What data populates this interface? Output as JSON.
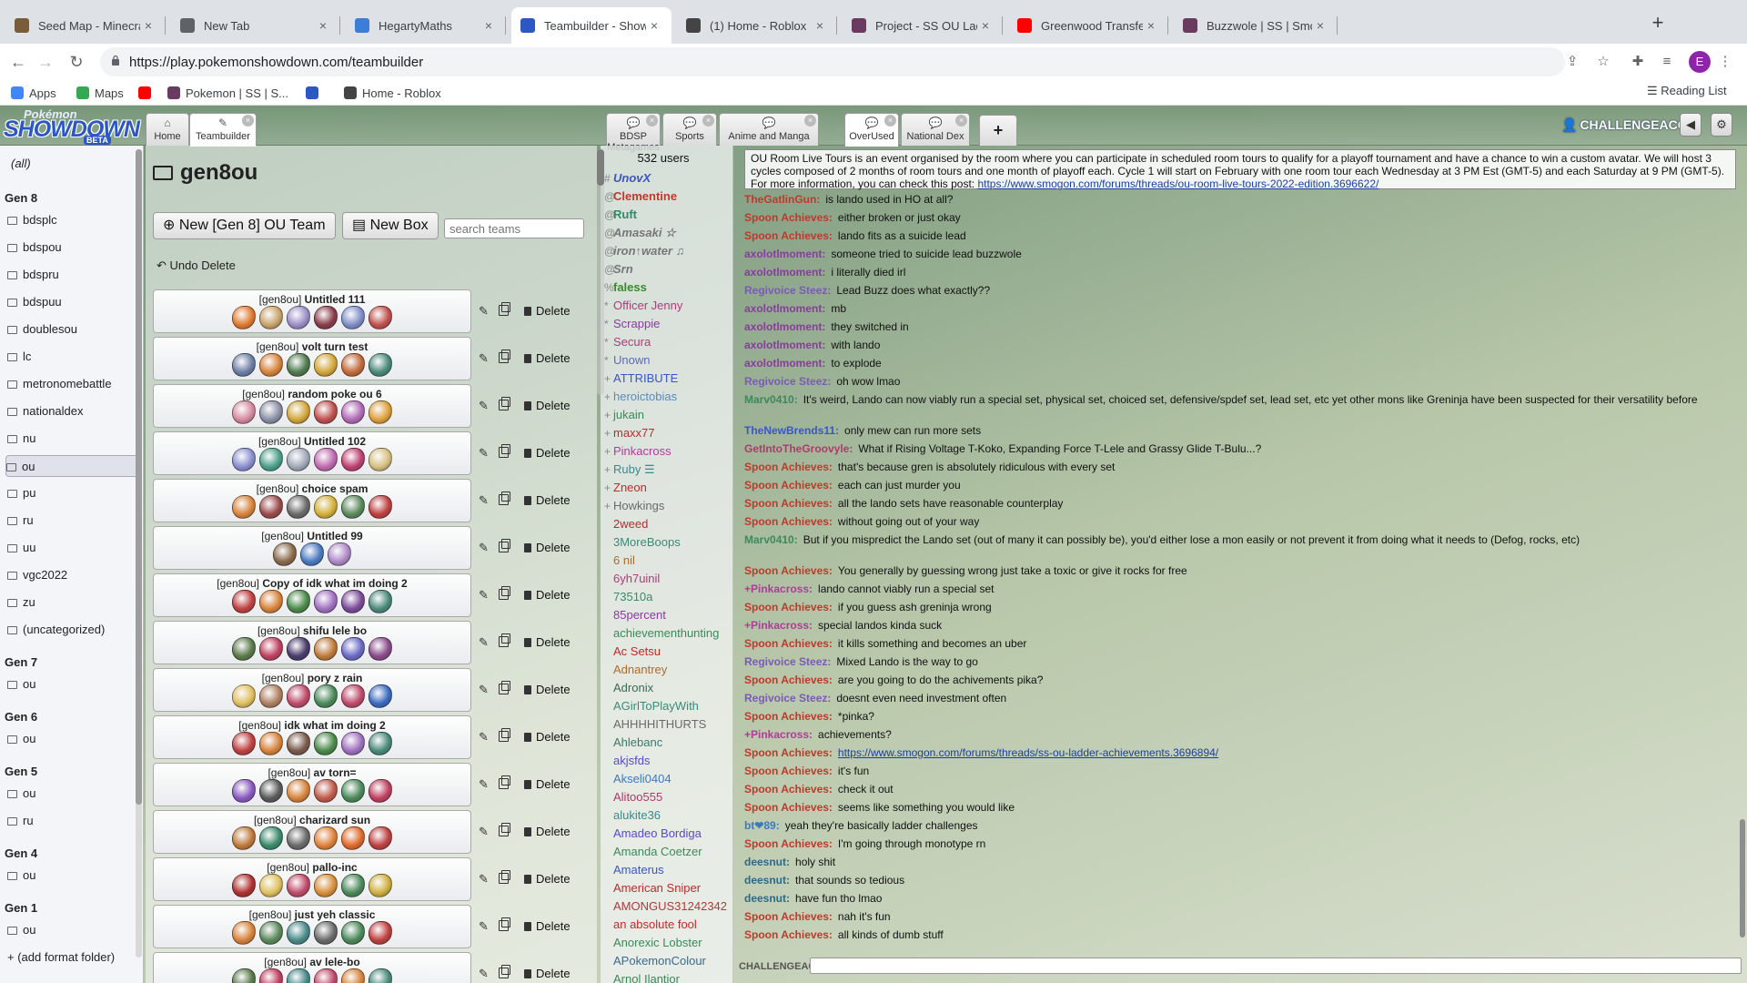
{
  "browser": {
    "tabs": [
      {
        "title": "Seed Map - Minecraft App",
        "icon": "minecraft-icon",
        "color": "#7a5c3a",
        "active": false
      },
      {
        "title": "New Tab",
        "icon": "chrome-icon",
        "color": "#5f6368",
        "active": false
      },
      {
        "title": "HegartyMaths",
        "icon": "hegartymaths-icon",
        "color": "#3b7dd8",
        "active": false
      },
      {
        "title": "Teambuilder - Showdown!",
        "icon": "showdown-icon",
        "color": "#2d58c4",
        "active": true
      },
      {
        "title": "(1) Home - Roblox",
        "icon": "roblox-icon",
        "color": "#444444",
        "active": false
      },
      {
        "title": "Project - SS OU Ladder Ach",
        "icon": "smogon-icon",
        "color": "#6a3b5e",
        "active": false
      },
      {
        "title": "Greenwood Transfer Re",
        "icon": "youtube-icon",
        "color": "#ff0000",
        "active": false
      },
      {
        "title": "Buzzwole | SS | Smogon Str",
        "icon": "smogon-icon",
        "color": "#6a3b5e",
        "active": false
      }
    ],
    "url": "https://play.pokemonshowdown.com/teambuilder",
    "profile_initial": "E",
    "bookmarks": [
      {
        "label": "Apps",
        "icon": "apps-grid-icon",
        "color": "#4285f4"
      },
      {
        "label": "Maps",
        "icon": "maps-pin-icon",
        "color": "#34a853"
      },
      {
        "label": "",
        "icon": "youtube-icon",
        "color": "#ff0000"
      },
      {
        "label": "Pokemon | SS | S...",
        "icon": "smogon-icon",
        "color": "#6a3b5e"
      },
      {
        "label": "",
        "icon": "showdown-s-icon",
        "color": "#2d58c4"
      },
      {
        "label": "Home - Roblox",
        "icon": "roblox-icon",
        "color": "#444444"
      }
    ],
    "reading_list": "Reading List"
  },
  "showdown": {
    "logo": {
      "top": "Pokémon",
      "main": "SHOWDOWN",
      "badge": "BETA"
    },
    "tabs": [
      {
        "label": "Home",
        "icon": "home-icon",
        "closable": false,
        "current": false
      },
      {
        "label": "Teambuilder",
        "icon": "pencil-icon",
        "closable": true,
        "current": true
      },
      {
        "label": "BDSP Metagames",
        "icon": "chat-bubble-icon",
        "closable": true,
        "current": false
      },
      {
        "label": "Sports",
        "icon": "chat-bubble-icon",
        "closable": true,
        "current": false
      },
      {
        "label": "Anime and Manga",
        "icon": "chat-bubble-icon",
        "closable": true,
        "current": false
      },
      {
        "label": "OverUsed",
        "icon": "chat-bubble-icon",
        "closable": true,
        "current": true
      },
      {
        "label": "National Dex",
        "icon": "chat-bubble-icon",
        "closable": true,
        "current": false
      }
    ],
    "add_tab": "+",
    "username": "CHALLENGEACC",
    "sound_icon": "sound-icon",
    "settings_icon": "gear-icon"
  },
  "folders": {
    "items": [
      {
        "label": "(all)",
        "kind": "all"
      },
      {
        "label": "Gen 8",
        "kind": "gen"
      },
      {
        "label": "bdsplc",
        "kind": "folder"
      },
      {
        "label": "bdspou",
        "kind": "folder"
      },
      {
        "label": "bdspru",
        "kind": "folder"
      },
      {
        "label": "bdspuu",
        "kind": "folder"
      },
      {
        "label": "doublesou",
        "kind": "folder"
      },
      {
        "label": "lc",
        "kind": "folder"
      },
      {
        "label": "metronomebattle",
        "kind": "folder"
      },
      {
        "label": "nationaldex",
        "kind": "folder"
      },
      {
        "label": "nu",
        "kind": "folder"
      },
      {
        "label": "ou",
        "kind": "folder",
        "selected": true
      },
      {
        "label": "pu",
        "kind": "folder"
      },
      {
        "label": "ru",
        "kind": "folder"
      },
      {
        "label": "uu",
        "kind": "folder"
      },
      {
        "label": "vgc2022",
        "kind": "folder"
      },
      {
        "label": "zu",
        "kind": "folder"
      },
      {
        "label": "(uncategorized)",
        "kind": "folder"
      },
      {
        "label": "Gen 7",
        "kind": "gen"
      },
      {
        "label": "ou",
        "kind": "folder"
      },
      {
        "label": "Gen 6",
        "kind": "gen"
      },
      {
        "label": "ou",
        "kind": "folder"
      },
      {
        "label": "Gen 5",
        "kind": "gen"
      },
      {
        "label": "ou",
        "kind": "folder"
      },
      {
        "label": "ru",
        "kind": "folder"
      },
      {
        "label": "Gen 4",
        "kind": "gen"
      },
      {
        "label": "ou",
        "kind": "folder"
      },
      {
        "label": "Gen 1",
        "kind": "gen"
      },
      {
        "label": "ou",
        "kind": "folder"
      },
      {
        "label": "+ (add format folder)",
        "kind": "add"
      }
    ]
  },
  "teambuilder": {
    "title": "gen8ou",
    "new_team_label": "New [Gen 8] OU Team",
    "new_box_label": "New Box",
    "search_placeholder": "search teams",
    "undo_label": "Undo Delete",
    "delete_label": "Delete",
    "teams": [
      {
        "format": "[gen8ou]",
        "name": "Untitled 111",
        "sprites": [
          "#e07a2e",
          "#c9a46a",
          "#9c8fc7",
          "#8a3b4a",
          "#7f8ec9",
          "#c0504d"
        ]
      },
      {
        "format": "[gen8ou]",
        "name": "volt turn test",
        "sprites": [
          "#6d7fa6",
          "#d8833a",
          "#4f7a4f",
          "#d4a63a",
          "#c46a3a",
          "#4a8a7a"
        ]
      },
      {
        "format": "[gen8ou]",
        "name": "random poke ou 6",
        "sprites": [
          "#d88aa0",
          "#8a8fa6",
          "#d4a63a",
          "#c0504d",
          "#b26ab8",
          "#e0a03a"
        ]
      },
      {
        "format": "[gen8ou]",
        "name": "Untitled 102",
        "sprites": [
          "#8a8fd0",
          "#4aa08a",
          "#a0a8b8",
          "#c06ab0",
          "#c04070",
          "#d8c080"
        ]
      },
      {
        "format": "[gen8ou]",
        "name": "choice spam",
        "sprites": [
          "#d8833a",
          "#9c4a4a",
          "#6a6a6a",
          "#d4b03a",
          "#5a8a5a",
          "#c04040"
        ]
      },
      {
        "format": "[gen8ou]",
        "name": "Untitled 99",
        "sprites": [
          "#8a6a4a",
          "#4a7ac0",
          "#b08ac8"
        ]
      },
      {
        "format": "[gen8ou]",
        "name": "Copy of idk what im doing 2",
        "sprites": [
          "#c04040",
          "#d8833a",
          "#4a8a4a",
          "#a070c0",
          "#7a4a9a",
          "#4a8a7a"
        ]
      },
      {
        "format": "[gen8ou]",
        "name": "shifu lele bo",
        "sprites": [
          "#5a7a4a",
          "#c04060",
          "#4a3a6a",
          "#c07a3a",
          "#6a6ac8",
          "#8a4a8a"
        ]
      },
      {
        "format": "[gen8ou]",
        "name": "pory z rain",
        "sprites": [
          "#e0c060",
          "#b08060",
          "#c04a6a",
          "#4a8a5a",
          "#c04a6a",
          "#3a6ac0"
        ]
      },
      {
        "format": "[gen8ou]",
        "name": "idk what im doing 2",
        "sprites": [
          "#c04040",
          "#d8833a",
          "#7a5a4a",
          "#4a8a4a",
          "#a070c0",
          "#4a8a7a"
        ]
      },
      {
        "format": "[gen8ou]",
        "name": "av torn=",
        "sprites": [
          "#8a5ac0",
          "#5a5a5a",
          "#d8833a",
          "#c05a4a",
          "#4a8a5a",
          "#c04060"
        ]
      },
      {
        "format": "[gen8ou]",
        "name": "charizard sun",
        "sprites": [
          "#c07a3a",
          "#3a8a6a",
          "#6a6a6a",
          "#e0833a",
          "#e06a2a",
          "#c04040"
        ]
      },
      {
        "format": "[gen8ou]",
        "name": "pallo-inc",
        "sprites": [
          "#b03030",
          "#e0c060",
          "#c04a6a",
          "#d8903a",
          "#4a8a5a",
          "#d0b040"
        ]
      },
      {
        "format": "[gen8ou]",
        "name": "just yeh classic",
        "sprites": [
          "#d8833a",
          "#5a8a5a",
          "#4a8a8a",
          "#6a6a6a",
          "#4a8a5a",
          "#c04040"
        ]
      },
      {
        "format": "[gen8ou]",
        "name": "av lele-bo",
        "sprites": [
          "#5a7a4a",
          "#c04060",
          "#4a8a8a",
          "#c04a6a",
          "#d8833a",
          "#4a8a7a"
        ]
      }
    ]
  },
  "room": {
    "user_count": "532 users",
    "users": [
      {
        "rank": "#",
        "name": "UnovX",
        "color": "#3a55c8",
        "bold": true,
        "italic": true
      },
      {
        "rank": "@",
        "name": "Clementine",
        "color": "#c0392b",
        "bold": true
      },
      {
        "rank": "@",
        "name": "Ruft",
        "color": "#2e8b6a",
        "bold": true
      },
      {
        "rank": "@",
        "name": "Amasaki ☆",
        "color": "#777777",
        "bold": true,
        "italic": true
      },
      {
        "rank": "@",
        "name": "iron↑water ♫",
        "color": "#777777",
        "bold": true,
        "italic": true
      },
      {
        "rank": "@",
        "name": "Srn",
        "color": "#777777",
        "bold": true,
        "italic": true
      },
      {
        "rank": "%",
        "name": "faless",
        "color": "#3a8a2a",
        "bold": true
      },
      {
        "rank": "*",
        "name": "Officer Jenny",
        "color": "#b03a7a"
      },
      {
        "rank": "*",
        "name": "Scrappie",
        "color": "#8a3aa0"
      },
      {
        "rank": "*",
        "name": "Secura",
        "color": "#b03a7a"
      },
      {
        "rank": "*",
        "name": "Unown",
        "color": "#5a6ac0"
      },
      {
        "rank": "+",
        "name": "ATTRIBUTE",
        "color": "#3a55c8"
      },
      {
        "rank": "+",
        "name": "heroictobias",
        "color": "#5a8ac0"
      },
      {
        "rank": "+",
        "name": "jukain",
        "color": "#3a8a5a"
      },
      {
        "rank": "+",
        "name": "maxx77",
        "color": "#b03030"
      },
      {
        "rank": "+",
        "name": "Pinkacross",
        "color": "#b03a9a"
      },
      {
        "rank": "+",
        "name": "Ruby ☰",
        "color": "#3a8a8a"
      },
      {
        "rank": "+",
        "name": "Zneon",
        "color": "#c02a2a"
      },
      {
        "rank": "+",
        "name": "Howkings",
        "color": "#6a6a6a"
      },
      {
        "rank": "",
        "name": "2weed",
        "color": "#b03030"
      },
      {
        "rank": "",
        "name": "3MoreBoops",
        "color": "#3a8a7a"
      },
      {
        "rank": "",
        "name": "6 nil",
        "color": "#b06a2a"
      },
      {
        "rank": "",
        "name": "6yh7uinil",
        "color": "#b03a7a"
      },
      {
        "rank": "",
        "name": "73510a",
        "color": "#3a8a6a"
      },
      {
        "rank": "",
        "name": "85percent",
        "color": "#8a3aa0"
      },
      {
        "rank": "",
        "name": "achievementhunting",
        "color": "#3a8a5a"
      },
      {
        "rank": "",
        "name": "Ac Setsu",
        "color": "#c02a2a"
      },
      {
        "rank": "",
        "name": "Adnantrey",
        "color": "#b06a2a"
      },
      {
        "rank": "",
        "name": "Adronix",
        "color": "#3a6a5a"
      },
      {
        "rank": "",
        "name": "AGirlToPlayWith",
        "color": "#3a8a7a"
      },
      {
        "rank": "",
        "name": "AHHHHITHURTS",
        "color": "#6a6a6a"
      },
      {
        "rank": "",
        "name": "Ahlebanc",
        "color": "#3a7a6a"
      },
      {
        "rank": "",
        "name": "akjsfds",
        "color": "#5a4ac8"
      },
      {
        "rank": "",
        "name": "Akseli0404",
        "color": "#3a7ac0"
      },
      {
        "rank": "",
        "name": "Alitoo555",
        "color": "#b03a6a"
      },
      {
        "rank": "",
        "name": "alukite36",
        "color": "#3a8a8a"
      },
      {
        "rank": "",
        "name": "Amadeo Bordiga",
        "color": "#5a4ac8"
      },
      {
        "rank": "",
        "name": "Amanda Coetzer",
        "color": "#3a8a5a"
      },
      {
        "rank": "",
        "name": "Amaterus",
        "color": "#3a55c8"
      },
      {
        "rank": "",
        "name": "American Sniper",
        "color": "#c02a2a"
      },
      {
        "rank": "",
        "name": "AMONGUS31242342",
        "color": "#b03a3a"
      },
      {
        "rank": "",
        "name": "an absolute fool",
        "color": "#c02a2a"
      },
      {
        "rank": "",
        "name": "Anorexic Lobster",
        "color": "#3a8a5a"
      },
      {
        "rank": "",
        "name": "APokemonColour",
        "color": "#3a6a8a"
      },
      {
        "rank": "",
        "name": "Arnol Ilantior",
        "color": "#3a8a5a"
      }
    ],
    "motd": {
      "text": "OU Room Live Tours is an event organised by the room where you can participate in scheduled room tours to qualify for a playoff tournament and have a chance to win a custom avatar. We will host 3 cycles composed of 2 months of room tours and one month of playoff each. Cycle 1 will start on February with one room tour each Wednesday at 3 PM Est (GMT-5) and each Saturday at 9 PM (GMT-5). For more information, you can check this post: ",
      "link": "https://www.smogon.com/forums/threads/ou-room-live-tours-2022-edition.3696622/"
    },
    "messages": [
      {
        "user": "TheGatlinGun:",
        "color": "#c0392b",
        "text": "is lando used in HO at all?"
      },
      {
        "user": "Spoon Achieves:",
        "color": "#c0392b",
        "text": "either broken or just okay"
      },
      {
        "user": "Spoon Achieves:",
        "color": "#c0392b",
        "text": "lando fits as a suicide lead"
      },
      {
        "user": "axolotlmoment:",
        "color": "#8a3aa0",
        "text": "someone tried to suicide lead buzzwole"
      },
      {
        "user": "axolotlmoment:",
        "color": "#8a3aa0",
        "text": "i literally died irl"
      },
      {
        "user": "Regivoice Steez:",
        "color": "#7a5ab8",
        "text": "Lead Buzz does what exactly??"
      },
      {
        "user": "axolotlmoment:",
        "color": "#8a3aa0",
        "text": "mb"
      },
      {
        "user": "axolotlmoment:",
        "color": "#8a3aa0",
        "text": "they switched in"
      },
      {
        "user": "axolotlmoment:",
        "color": "#8a3aa0",
        "text": "with lando"
      },
      {
        "user": "axolotlmoment:",
        "color": "#8a3aa0",
        "text": "to explode"
      },
      {
        "user": "Regivoice Steez:",
        "color": "#7a5ab8",
        "text": "oh wow lmao"
      },
      {
        "user": "Marv0410:",
        "color": "#3a8a5a",
        "text": "It's weird, Lando can now viably run a special set, physical set, choiced set, defensive/spdef set, lead set, etc yet other mons like Greninja have been suspected for their versatility before"
      },
      {
        "user": "TheNewBrends11:",
        "color": "#3a55c8",
        "text": "only mew can run more sets"
      },
      {
        "user": "GetIntoTheGroovyle:",
        "color": "#b03a6a",
        "text": "What if Rising Voltage T-Koko, Expanding Force T-Lele and Grassy Glide T-Bulu...?"
      },
      {
        "user": "Spoon Achieves:",
        "color": "#c0392b",
        "text": "that's because gren is absolutely ridiculous with every set"
      },
      {
        "user": "Spoon Achieves:",
        "color": "#c0392b",
        "text": "each can just murder you"
      },
      {
        "user": "Spoon Achieves:",
        "color": "#c0392b",
        "text": "all the lando sets have reasonable counterplay"
      },
      {
        "user": "Spoon Achieves:",
        "color": "#c0392b",
        "text": "without going out of your way"
      },
      {
        "user": "Marv0410:",
        "color": "#3a8a5a",
        "text": "But if you mispredict the Lando set (out of many it can possibly be), you'd either lose a mon easily or not prevent it from doing what it needs to (Defog, rocks, etc)"
      },
      {
        "user": "Spoon Achieves:",
        "color": "#c0392b",
        "text": "You generally by guessing wrong just take a toxic or give it rocks for free"
      },
      {
        "user": "+Pinkacross:",
        "color": "#b03a9a",
        "text": "lando cannot viably run a special set"
      },
      {
        "user": "Spoon Achieves:",
        "color": "#c0392b",
        "text": "if you guess ash greninja wrong"
      },
      {
        "user": "+Pinkacross:",
        "color": "#b03a9a",
        "text": "special landos kinda suck"
      },
      {
        "user": "Spoon Achieves:",
        "color": "#c0392b",
        "text": "it kills something and becomes an uber"
      },
      {
        "user": "Regivoice Steez:",
        "color": "#7a5ab8",
        "text": "Mixed Lando is the way to go"
      },
      {
        "user": "Spoon Achieves:",
        "color": "#c0392b",
        "text": "are you going to do the achivements pika?"
      },
      {
        "user": "Regivoice Steez:",
        "color": "#7a5ab8",
        "text": "doesnt even need investment often"
      },
      {
        "user": "Spoon Achieves:",
        "color": "#c0392b",
        "text": "*pinka?"
      },
      {
        "user": "+Pinkacross:",
        "color": "#b03a9a",
        "text": "achievements?"
      },
      {
        "user": "Spoon Achieves:",
        "color": "#c0392b",
        "text": "",
        "link": "https://www.smogon.com/forums/threads/ss-ou-ladder-achievements.3696894/"
      },
      {
        "user": "Spoon Achieves:",
        "color": "#c0392b",
        "text": "it's fun"
      },
      {
        "user": "Spoon Achieves:",
        "color": "#c0392b",
        "text": "check it out"
      },
      {
        "user": "Spoon Achieves:",
        "color": "#c0392b",
        "text": "seems like something you would like"
      },
      {
        "user": "bt❤89:",
        "color": "#3a7ac0",
        "text": "yeah they're basically ladder challenges"
      },
      {
        "user": "Spoon Achieves:",
        "color": "#c0392b",
        "text": "I'm going through monotype rn"
      },
      {
        "user": "deesnut:",
        "color": "#2a6a8a",
        "text": "holy shit"
      },
      {
        "user": "deesnut:",
        "color": "#2a6a8a",
        "text": "that sounds so tedious"
      },
      {
        "user": "deesnut:",
        "color": "#2a6a8a",
        "text": "have fun tho lmao"
      },
      {
        "user": "Spoon Achieves:",
        "color": "#c0392b",
        "text": "nah it's fun"
      },
      {
        "user": "Spoon Achieves:",
        "color": "#c0392b",
        "text": "all kinds of dumb stuff"
      }
    ],
    "chatbox_label": "CHALLENGEAC"
  }
}
